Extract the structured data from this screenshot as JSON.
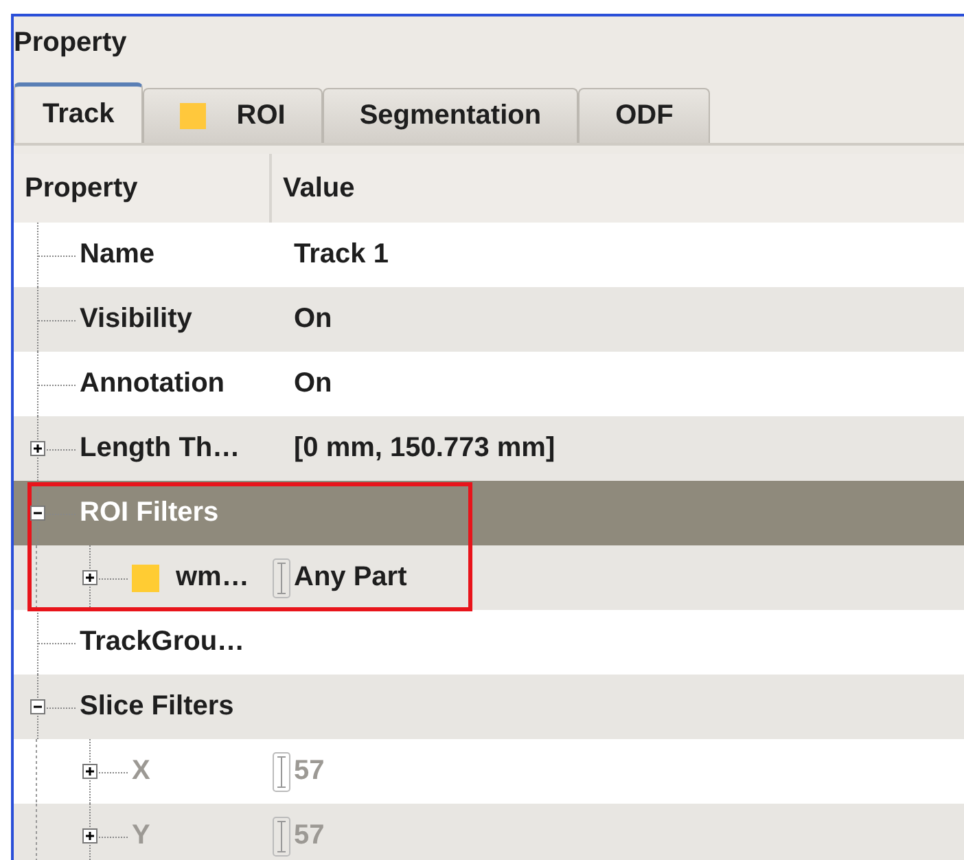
{
  "panel": {
    "title": "Property"
  },
  "tabs": [
    {
      "label": "Track",
      "selected": true
    },
    {
      "label": "ROI",
      "selected": false,
      "color": "#ffc83c"
    },
    {
      "label": "Segmentation",
      "selected": false
    },
    {
      "label": "ODF",
      "selected": false
    }
  ],
  "table": {
    "columns": [
      "Property",
      "Value"
    ],
    "rows": [
      {
        "name": "Name",
        "value": "Track 1",
        "selected": false
      },
      {
        "name": "Visibility",
        "value": "On",
        "selected": false
      },
      {
        "name": "Annotation",
        "value": "On",
        "selected": false
      },
      {
        "name": "Length Th…",
        "value": "[0 mm,  150.773 mm]",
        "expanded": false,
        "selected": false
      },
      {
        "name": "ROI Filters",
        "expanded": true,
        "selected": true,
        "highlighted": true,
        "children": [
          {
            "name": "wm…",
            "value": "Any Part",
            "expanded": false,
            "color": "#ffcc33",
            "editable": true,
            "selected": false,
            "highlighted": true
          }
        ]
      },
      {
        "name": "TrackGrou…",
        "selected": false
      },
      {
        "name": "Slice Filters",
        "expanded": true,
        "selected": false,
        "children": [
          {
            "name": "X",
            "value": "57",
            "expanded": false,
            "editable": true,
            "disabled": true,
            "selected": false
          },
          {
            "name": "Y",
            "value": "57",
            "expanded": false,
            "editable": true,
            "disabled": true,
            "selected": false
          }
        ]
      }
    ]
  }
}
